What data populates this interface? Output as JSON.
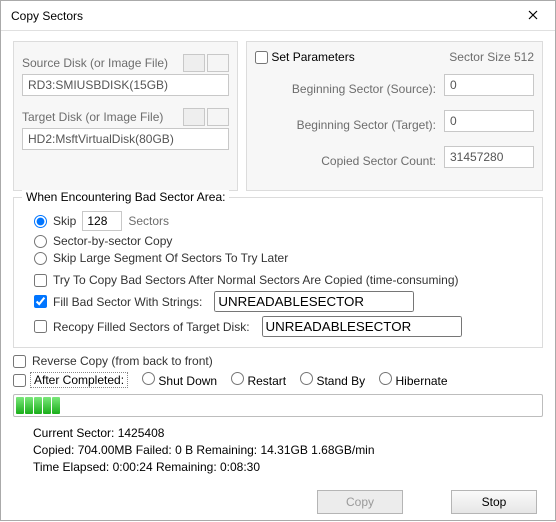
{
  "window": {
    "title": "Copy Sectors"
  },
  "source": {
    "label": "Source Disk (or Image File)",
    "value": "RD3:SMIUSBDISK(15GB)"
  },
  "target": {
    "label": "Target Disk (or Image File)",
    "value": "HD2:MsftVirtualDisk(80GB)"
  },
  "params": {
    "set_label": "Set Parameters",
    "sector_size_label": "Sector Size 512",
    "begin_src_label": "Beginning Sector (Source):",
    "begin_src_value": "0",
    "begin_tgt_label": "Beginning Sector (Target):",
    "begin_tgt_value": "0",
    "count_label": "Copied Sector Count:",
    "count_value": "31457280"
  },
  "bad": {
    "legend": "When Encountering Bad Sector Area:",
    "skip_label": "Skip",
    "skip_value": "128",
    "skip_unit": "Sectors",
    "sbs_label": "Sector-by-sector Copy",
    "large_label": "Skip Large Segment Of Sectors To Try Later",
    "try_label": "Try To Copy Bad Sectors After Normal Sectors Are Copied (time-consuming)",
    "fill_label": "Fill Bad Sector With Strings:",
    "fill_value": "UNREADABLESECTOR",
    "recopy_label": "Recopy Filled Sectors of Target Disk:",
    "recopy_value": "UNREADABLESECTOR"
  },
  "reverse_label": "Reverse Copy (from back to front)",
  "after": {
    "label": "After Completed:",
    "options": [
      "Shut Down",
      "Restart",
      "Stand By",
      "Hibernate"
    ]
  },
  "progress": {
    "seg_count": 5
  },
  "stats": {
    "line1a": "Current Sector: ",
    "line1b": "1425408",
    "line2": "Copied: 704.00MB  Failed: 0 B  Remaining: 14.31GB  1.68GB/min",
    "line3": "Time Elapsed:  0:00:24  Remaining:  0:08:30"
  },
  "buttons": {
    "copy": "Copy",
    "stop": "Stop"
  }
}
